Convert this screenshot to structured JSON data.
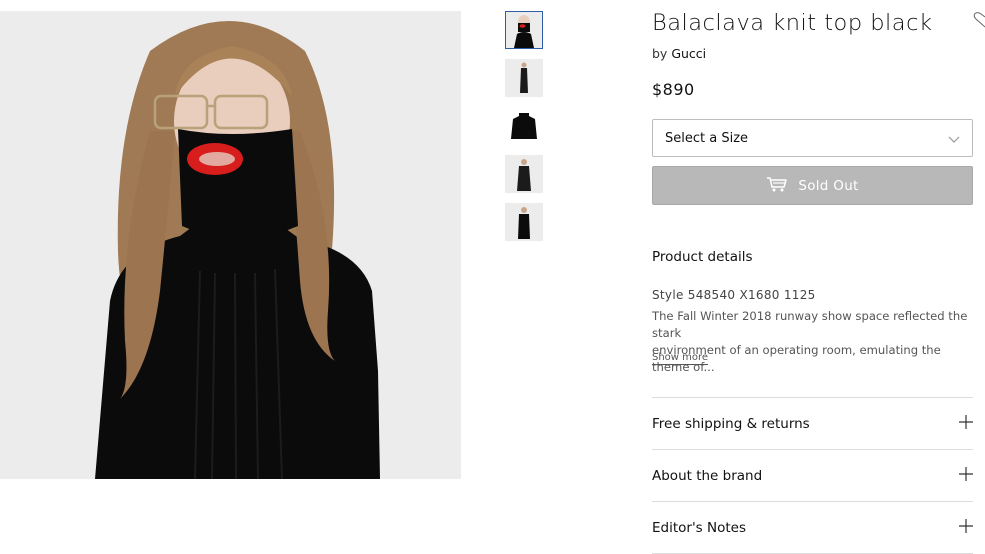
{
  "product": {
    "title": "Balaclava knit top black",
    "by_prefix": "by",
    "brand": "Gucci",
    "price": "$890"
  },
  "size_select": {
    "placeholder": "Select a Size"
  },
  "cta": {
    "label": "Sold Out",
    "icon": "cart-icon"
  },
  "details": {
    "heading": "Product details",
    "style": "Style 548540 X1680 1125",
    "description": "The Fall Winter 2018 runway show space reflected the stark\nenvironment of an operating room, emulating the theme of...",
    "show_more": "Show more"
  },
  "accordions": [
    {
      "label": "Free shipping & returns"
    },
    {
      "label": "About the brand"
    },
    {
      "label": "Editor's Notes"
    }
  ],
  "colors": {
    "sold_out_bg": "#b8b8b8",
    "thumb_active_border": "#2f5da8",
    "garment": "#0b0b0b",
    "lips": "#d81d1d"
  }
}
